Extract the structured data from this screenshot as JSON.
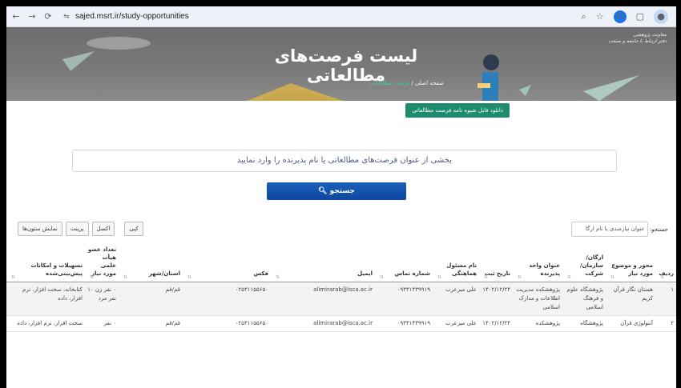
{
  "browser": {
    "url": "sajed.msrt.ir/study-opportunities",
    "icons": [
      "back-icon",
      "forward-icon",
      "reload-icon",
      "site-settings-icon",
      "zoom-icon",
      "star-icon",
      "extension-icon",
      "puzzle-icon",
      "profile-icon"
    ]
  },
  "header": {
    "title": "لیست فرصت‌های مطالعاتی",
    "breadcrumb_home": "صفحه اصلی",
    "breadcrumb_sep": "/",
    "breadcrumb_current": "فرصت مطالعاتی",
    "logo_line1": "معاونت پژوهشی",
    "logo_line2": "دفتر ارتباط با جامعه و صنعت"
  },
  "download_button": "دانلود فایل شیوه نامه فرصت مطالعاتی",
  "search": {
    "placeholder": "بخشی از عنوان فرصت‌های مطالعاتی یا نام پذیرنده را وارد نمایید",
    "button": "جستجو"
  },
  "toolbar": {
    "copy": "کپی",
    "excel": "اکسل",
    "print": "پرینت",
    "columns": "نمایش ستون‌ها"
  },
  "filter": {
    "label": "جستجو:",
    "placeholder": "عنوان نیازمندی یا نام ارگا"
  },
  "table": {
    "headers": {
      "row": "ردیف",
      "topic": "محور و موضوع مورد نیاز",
      "org": "ارگان/ سازمان/ شرکت",
      "unit": "عنوان واحد پذیرنده",
      "date": "تاریخ ثبت",
      "coordinator": "نام مسئول هماهنگی",
      "phone": "شماره تماس",
      "email": "ایمیل",
      "fax": "فکس",
      "city": "استان/شهر",
      "faculty": "تعداد عضو هیأت علمی مورد نیاز",
      "facilities": "تسهیلات و امکانات پیش‌بینی‌شده"
    },
    "rows": [
      {
        "row": "۱",
        "topic": "هستان نگار قرآن کریم",
        "org": "پژوهشگاه علوم و فرهنگ اسلامی",
        "unit": "پژوهشکده مدیریت اطلاعات و مدارک اسلامی",
        "date": "۱۴۰۲/۱۲/۲۴",
        "coordinator": "علی میرعرب",
        "phone": "۰۹۳۳۱۴۳۹۹۱۹",
        "email": "alimirarab@isca.ac.ir",
        "fax": "۰۲۵۳۱۱۵۵۶۵۰",
        "city": "قم/قم",
        "faculty": "۰ نفر زن ۱۰ نفر مرد",
        "facilities": "کتابخانه، سخت افزار، نرم افزار، داده"
      },
      {
        "row": "۲",
        "topic": "آنتولوژی قرآن",
        "org": "پژوهشگاه",
        "unit": "پژوهشکده",
        "date": "۱۴۰۲/۱۲/۲۴",
        "coordinator": "علی میرعرب",
        "phone": "۰۹۳۳۱۴۳۹۹۱۹",
        "email": "alimirarab@isca.ac.ir",
        "fax": "۰۲۵۳۱۱۵۵۶۵۰",
        "city": "قم/قم",
        "faculty": "۰ نفر",
        "facilities": "سخت افزار، نرم افزار، داده"
      }
    ]
  }
}
